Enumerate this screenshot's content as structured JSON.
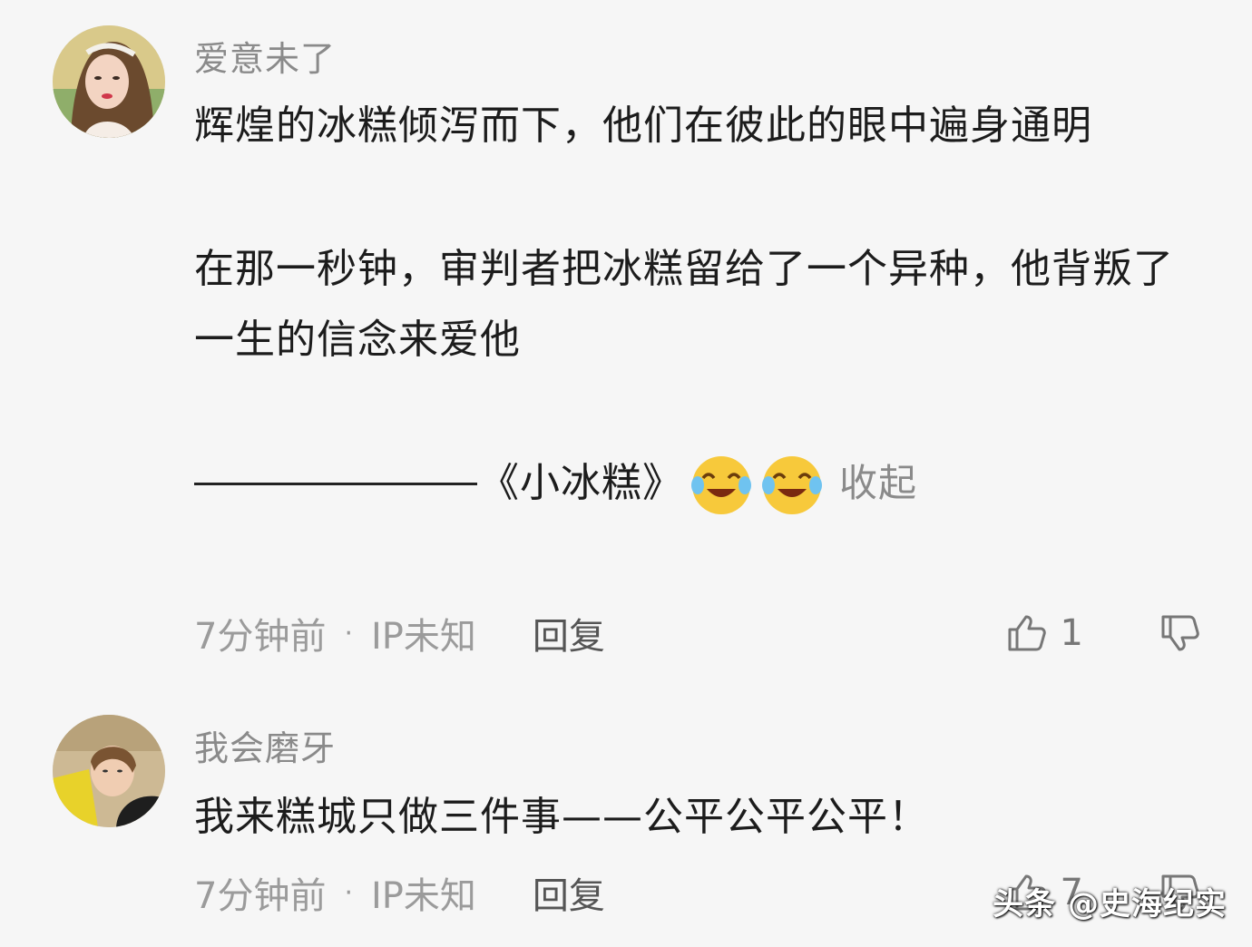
{
  "comments": [
    {
      "username": "爱意未了",
      "paragraphs": [
        "辉煌的冰糕倾泻而下，他们在彼此的眼中遍身通明",
        "在那一秒钟，审判者把冰糕留给了一个异种，他背叛了一生的信念来爱他"
      ],
      "signature": "《小冰糕》",
      "emoji": "crying-laugh-emoji",
      "collapse_label": "收起",
      "time": "7分钟前",
      "separator": "·",
      "ip": "IP未知",
      "reply_label": "回复",
      "like_count": "1"
    },
    {
      "username": "我会磨牙",
      "text": "我来糕城只做三件事——公平公平公平！",
      "time": "7分钟前",
      "separator": "·",
      "ip": "IP未知",
      "reply_label": "回复",
      "like_count": "7"
    }
  ],
  "watermark": "头条 @史海纪实",
  "colors": {
    "background": "#f6f6f6",
    "text": "#1c1c1c",
    "meta": "#9b9b9b",
    "emoji_face": "#f7c93b"
  }
}
